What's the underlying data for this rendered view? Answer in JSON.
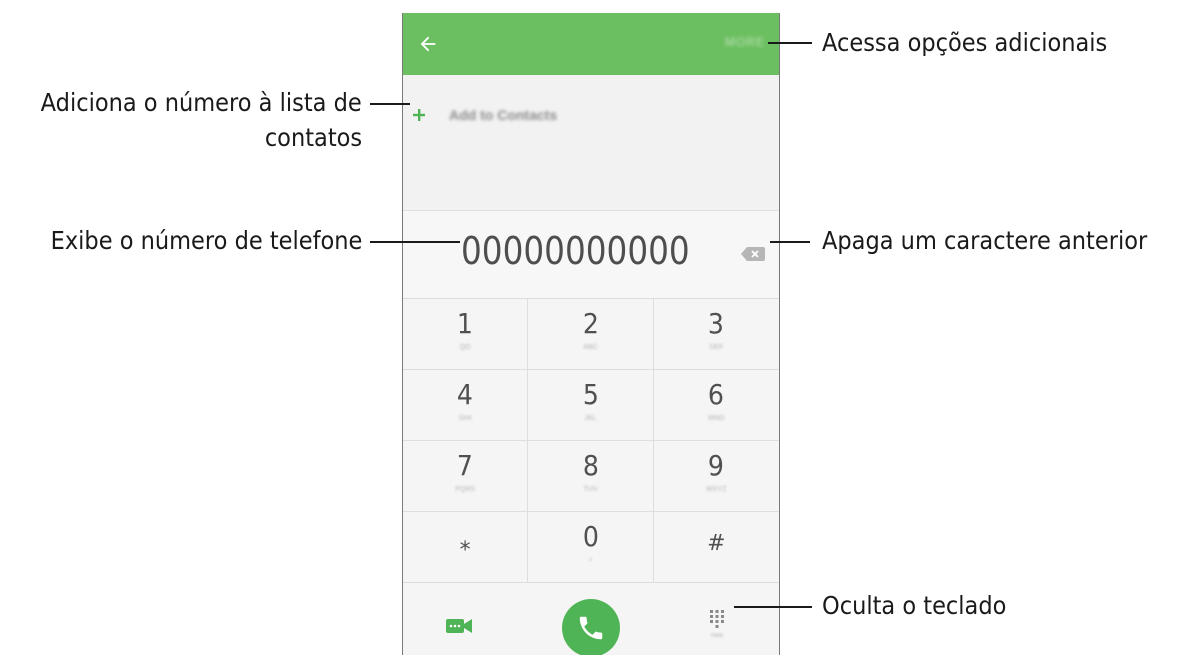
{
  "phone": {
    "appbar": {
      "more_label": "MORE"
    },
    "add_contacts_label": "Add to Contacts",
    "phone_number": "00000000000",
    "keypad": [
      {
        "digit": "1",
        "sub": "QO"
      },
      {
        "digit": "2",
        "sub": "ABC"
      },
      {
        "digit": "3",
        "sub": "DEF"
      },
      {
        "digit": "4",
        "sub": "GHI"
      },
      {
        "digit": "5",
        "sub": "JKL"
      },
      {
        "digit": "6",
        "sub": "MNO"
      },
      {
        "digit": "7",
        "sub": "PQRS"
      },
      {
        "digit": "8",
        "sub": "TUV"
      },
      {
        "digit": "9",
        "sub": "WXYZ"
      },
      {
        "digit": "⁎",
        "sub": ""
      },
      {
        "digit": "0",
        "sub": "+"
      },
      {
        "digit": "#",
        "sub": ""
      }
    ],
    "hide_keypad_sub": "Hide",
    "colors": {
      "appbar": "#6cbf61",
      "call_button": "#4fb456",
      "accent_green": "#4fb456"
    },
    "icons": {
      "back": "back-arrow-icon",
      "add": "plus-icon",
      "backspace": "backspace-icon",
      "video": "video-call-icon",
      "call": "phone-icon",
      "keypad": "dialpad-icon"
    }
  },
  "callouts": {
    "more_options": "Acessa opções adicionais",
    "add_to_contacts_line1": "Adiciona o número à lista de",
    "add_to_contacts_line2": "contatos",
    "show_number": "Exibe o número de telefone",
    "delete_char": "Apaga um caractere anterior",
    "hide_keypad": "Oculta o teclado"
  }
}
